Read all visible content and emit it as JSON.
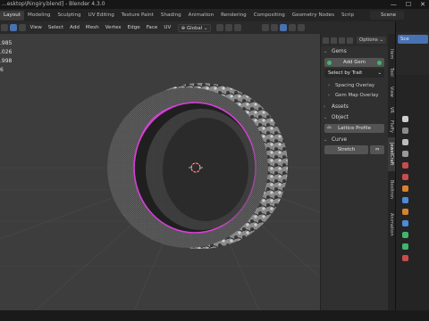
{
  "window": {
    "title": "...esktop\\Ringiry.blend] - Blender 4.3.0"
  },
  "topbar": {
    "tabs": [
      "Layout",
      "Modeling",
      "Sculpting",
      "UV Editing",
      "Texture Paint",
      "Shading",
      "Animation",
      "Rendering",
      "Compositing",
      "Geometry Nodes",
      "Scrip"
    ],
    "scene": "Scene"
  },
  "header": {
    "menus": [
      "View",
      "Select",
      "Add",
      "Mesh",
      "Vertex",
      "Edge",
      "Face",
      "UV"
    ],
    "orientation": "Global"
  },
  "stats": {
    "lines": [
      ".985",
      ".026",
      ".998",
      "6"
    ]
  },
  "sidebar": {
    "options_label": "Options",
    "gems_panel": "Gems",
    "add_gem": "Add Gem",
    "select_by_trait": "Select by Trait",
    "spacing_overlay": "Spacing Overlay",
    "gem_map_overlay": "Gem Map Overlay",
    "assets_panel": "Assets",
    "object_panel": "Object",
    "lattice_profile": "Lattice Profile",
    "curve_panel": "Curve",
    "stretch": "Stretch"
  },
  "side_tabs": [
    "Item",
    "Tool",
    "View",
    "VR",
    "Fluffy",
    "JewelCraft",
    "Booltron",
    "Animation"
  ],
  "outliner": {
    "label": "Sce"
  },
  "colors": {
    "accent": "#4772b3",
    "selected_mesh": "#d93fd9",
    "gem_green": "#3fb66b"
  }
}
